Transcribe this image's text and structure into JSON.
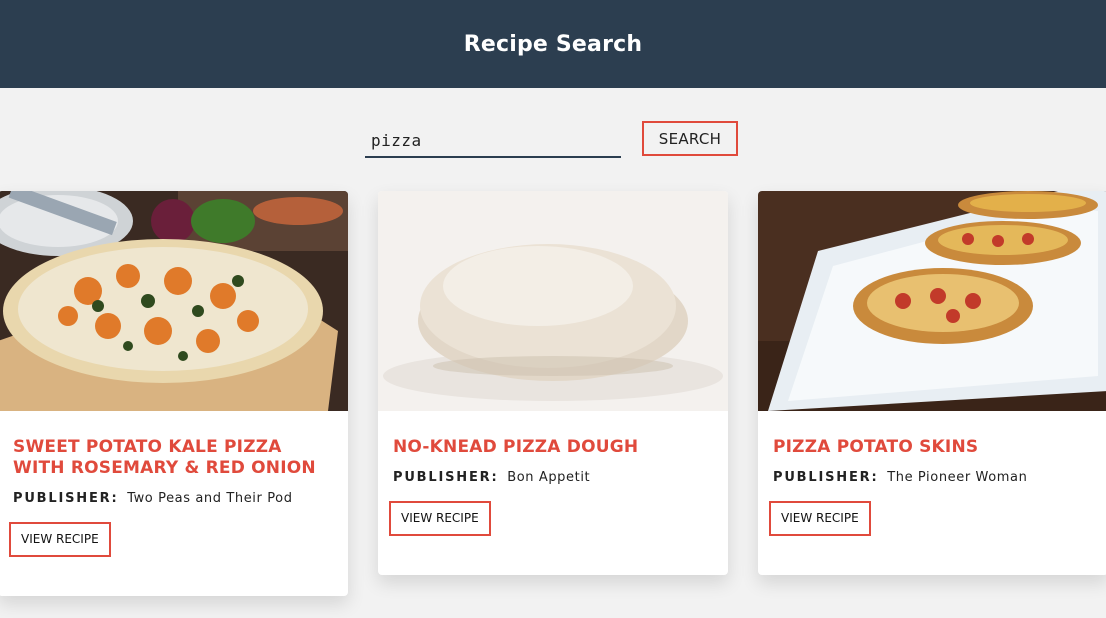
{
  "header": {
    "title": "Recipe Search"
  },
  "search": {
    "value": "pizza",
    "button_label": "SEARCH"
  },
  "publisher_label": "PUBLISHER:",
  "view_recipe_label": "VIEW RECIPE",
  "recipes": [
    {
      "title": "Sweet Potato Kale Pizza with Rosemary & Red Onion",
      "publisher": "Two Peas and Their Pod",
      "image": "pizza-photo"
    },
    {
      "title": "No-Knead Pizza Dough",
      "publisher": "Bon Appetit",
      "image": "dough-photo"
    },
    {
      "title": "Pizza Potato Skins",
      "publisher": "The Pioneer Woman",
      "image": "potato-skins-photo"
    }
  ],
  "colors": {
    "header_bg": "#2c3e50",
    "accent": "#e04a3c",
    "page_bg": "#f2f2f2"
  }
}
